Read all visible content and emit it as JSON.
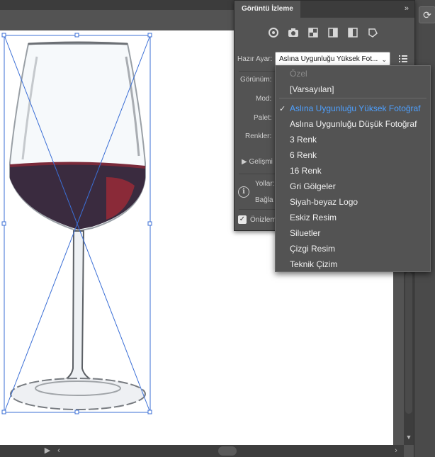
{
  "panel": {
    "title": "Görüntü İzleme",
    "collapse_glyph": "»",
    "preset_label": "Hazır Ayar:",
    "preset_value": "Aslına Uygunluğu Yüksek Fot...",
    "view_label": "Görünüm:",
    "mode_label": "Mod:",
    "palette_label": "Palet:",
    "colors_label": "Renkler:",
    "advanced_label": "Gelişmi",
    "paths_label": "Yollar:",
    "anchors_label": "Bağla",
    "preview_label": "Önizlem",
    "icons": [
      "auto-color-icon",
      "high-color-icon",
      "low-color-icon",
      "grayscale-icon",
      "black-white-icon",
      "outline-icon"
    ]
  },
  "menu": {
    "items": [
      {
        "label": "Özel",
        "state": "disabled"
      },
      {
        "label": "[Varsayılan]",
        "state": "normal"
      },
      {
        "label": "Aslına Uygunluğu Yüksek Fotoğraf",
        "state": "selected"
      },
      {
        "label": "Aslına Uygunluğu Düşük Fotoğraf",
        "state": "normal"
      },
      {
        "label": "3 Renk",
        "state": "normal"
      },
      {
        "label": "6 Renk",
        "state": "normal"
      },
      {
        "label": "16 Renk",
        "state": "normal"
      },
      {
        "label": "Gri Gölgeler",
        "state": "normal"
      },
      {
        "label": "Siyah-beyaz Logo",
        "state": "normal"
      },
      {
        "label": "Eskiz Resim",
        "state": "normal"
      },
      {
        "label": "Siluetler",
        "state": "normal"
      },
      {
        "label": "Çizgi Resim",
        "state": "normal"
      },
      {
        "label": "Teknik Çizim",
        "state": "normal"
      }
    ]
  },
  "colors": {
    "accent": "#4ea0ff",
    "selection": "#3b6fd6",
    "wine": "#3a2b3f"
  }
}
